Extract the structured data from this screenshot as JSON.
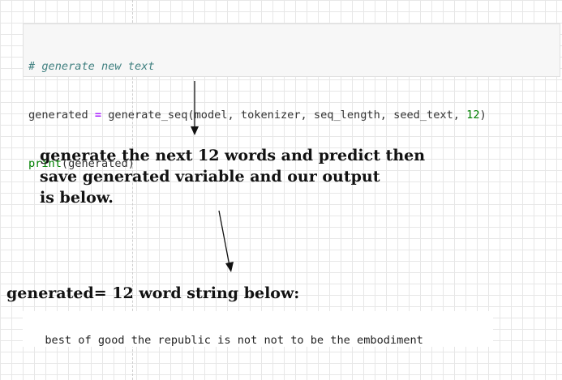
{
  "code_cell": {
    "comment": "# generate new text",
    "line2_var": "generated ",
    "line2_op": "=",
    "line2_call": " generate_seq(model, tokenizer, seq_length, seed_text, ",
    "line2_num": "12",
    "line2_end": ")",
    "line3_fn": "print",
    "line3_rest": "(generated)"
  },
  "annotation_1": {
    "line1": "generate the next 12 words and predict then",
    "line2": "save generated variable and our output",
    "line3": "is below."
  },
  "annotation_2": "generated= 12 word string below:",
  "output": "best of good the republic is not not to be the embodiment"
}
